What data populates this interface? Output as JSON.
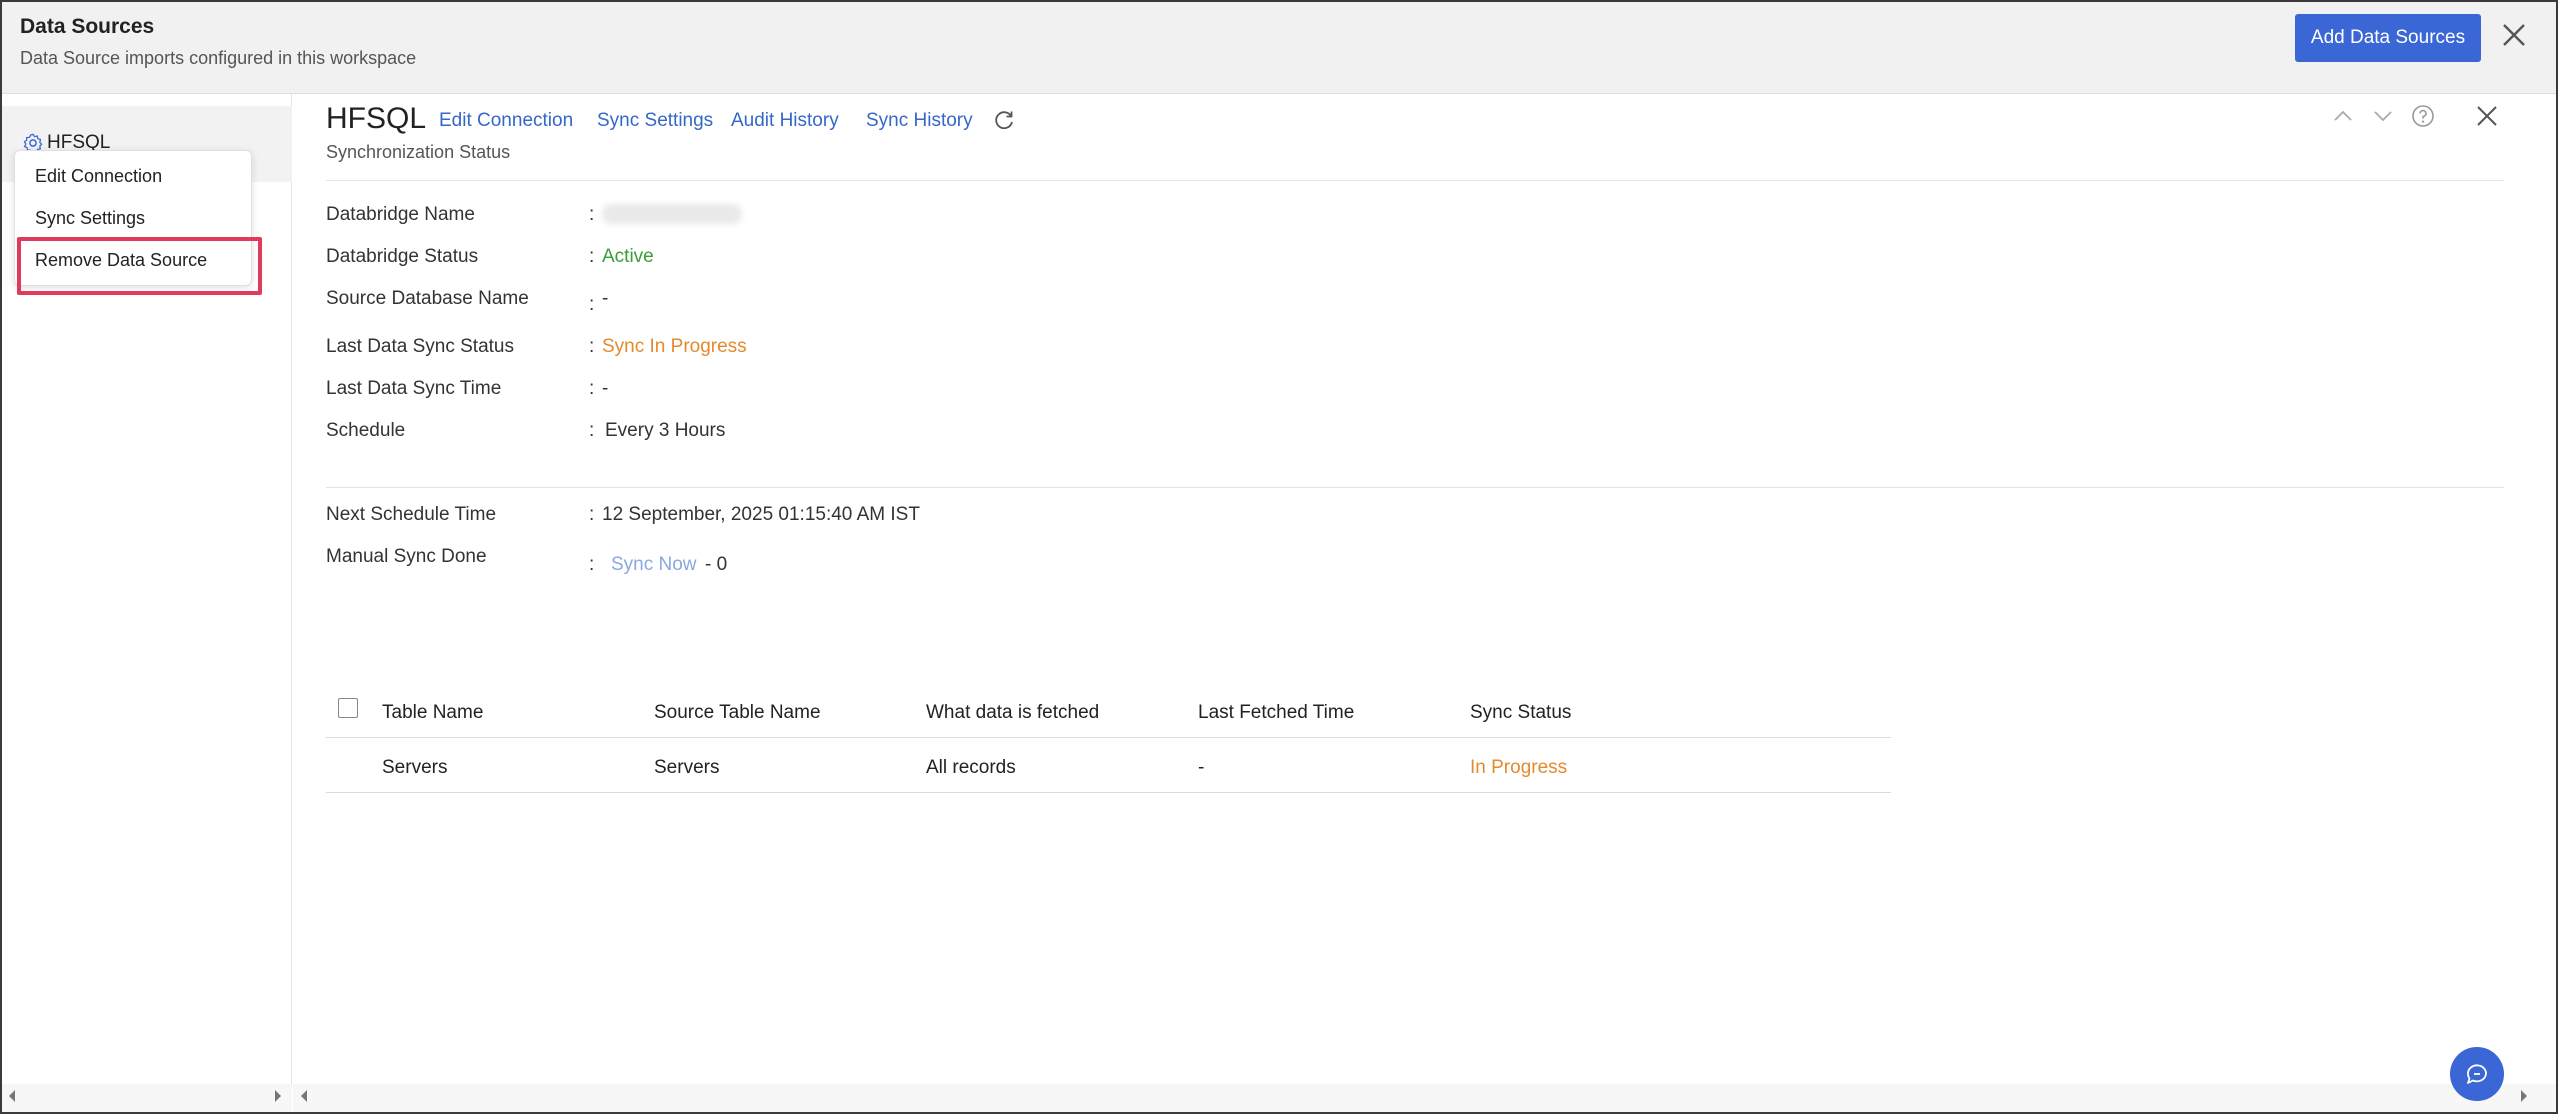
{
  "topbar": {
    "title": "Data Sources",
    "subtitle": "Data Source imports configured in this workspace",
    "add_button": "Add Data Sources"
  },
  "sidebar": {
    "data_source_name": "HFSQL",
    "context_menu": [
      "Edit Connection",
      "Sync Settings",
      "Remove Data Source"
    ]
  },
  "header": {
    "name": "HFSQL",
    "links": [
      "Edit Connection",
      "Sync Settings",
      "Audit History",
      "Sync History"
    ],
    "section_label": "Synchronization Status"
  },
  "details": [
    {
      "label": "Databridge Name",
      "value": ""
    },
    {
      "label": "Databridge Status",
      "value": "Active"
    },
    {
      "label": "Source Database Name",
      "value": "-"
    },
    {
      "label": "Last Data Sync Status",
      "value": "Sync In Progress"
    },
    {
      "label": "Last Data Sync Time",
      "value": "-"
    },
    {
      "label": "Schedule",
      "value": "Every 3 Hours"
    }
  ],
  "schedule": {
    "next_label": "Next Schedule Time",
    "next_value": "12 September, 2025 01:15:40 AM IST",
    "manual_label": "Manual Sync Done",
    "sync_now": "Sync Now",
    "manual_count": "- 0"
  },
  "table": {
    "headers": [
      "Table Name",
      "Source Table Name",
      "What data is fetched",
      "Last Fetched Time",
      "Sync Status"
    ],
    "rows": [
      [
        "Servers",
        "Servers",
        "All records",
        "-",
        "In Progress"
      ]
    ]
  },
  "colors": {
    "accent": "#3a66d6",
    "link": "#3567c8",
    "active": "#3a9d3a",
    "in_progress": "#e48a2e",
    "highlight": "#e03a5c"
  }
}
